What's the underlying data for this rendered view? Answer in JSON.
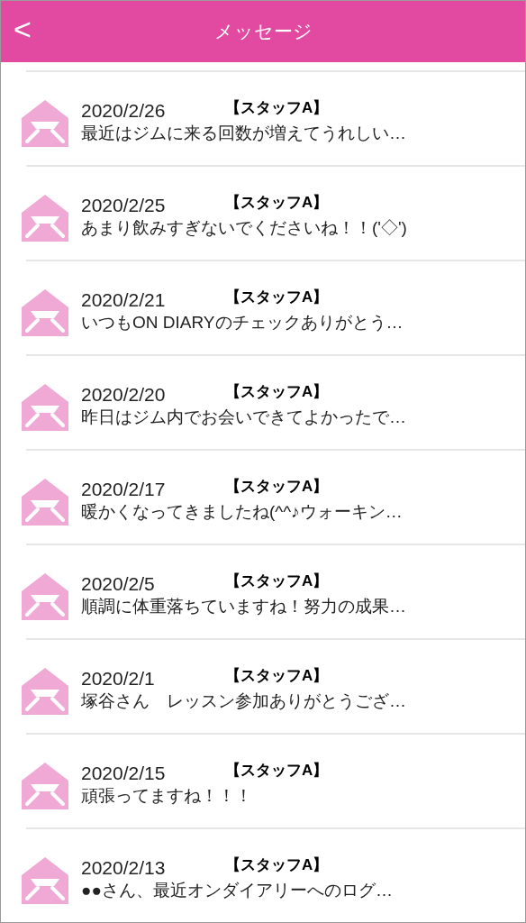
{
  "header": {
    "back": "<",
    "title": "メッセージ"
  },
  "messages": [
    {
      "date": "2020/2/26",
      "sender": "【スタッフA】",
      "text": "最近はジムに来る回数が増えてうれしい…"
    },
    {
      "date": "2020/2/25",
      "sender": "【スタッフA】",
      "text": "あまり飲みすぎないでくださいね！！('◇')"
    },
    {
      "date": "2020/2/21",
      "sender": "【スタッフA】",
      "text": "いつもON DIARYのチェックありがとう…"
    },
    {
      "date": "2020/2/20",
      "sender": "【スタッフA】",
      "text": "昨日はジム内でお会いできてよかったで…"
    },
    {
      "date": "2020/2/17",
      "sender": "【スタッフA】",
      "text": "暖かくなってきましたね(^^♪ウォーキン…"
    },
    {
      "date": "2020/2/5",
      "sender": "【スタッフA】",
      "text": "順調に体重落ちていますね！努力の成果…"
    },
    {
      "date": "2020/2/1",
      "sender": "【スタッフA】",
      "text": "塚谷さん　レッスン参加ありがとうござ…"
    },
    {
      "date": "2020/2/15",
      "sender": "【スタッフA】",
      "text": "頑張ってますね！！！"
    },
    {
      "date": "2020/2/13",
      "sender": "【スタッフA】",
      "text": "●●さん、最近オンダイアリーへのログ…"
    }
  ]
}
